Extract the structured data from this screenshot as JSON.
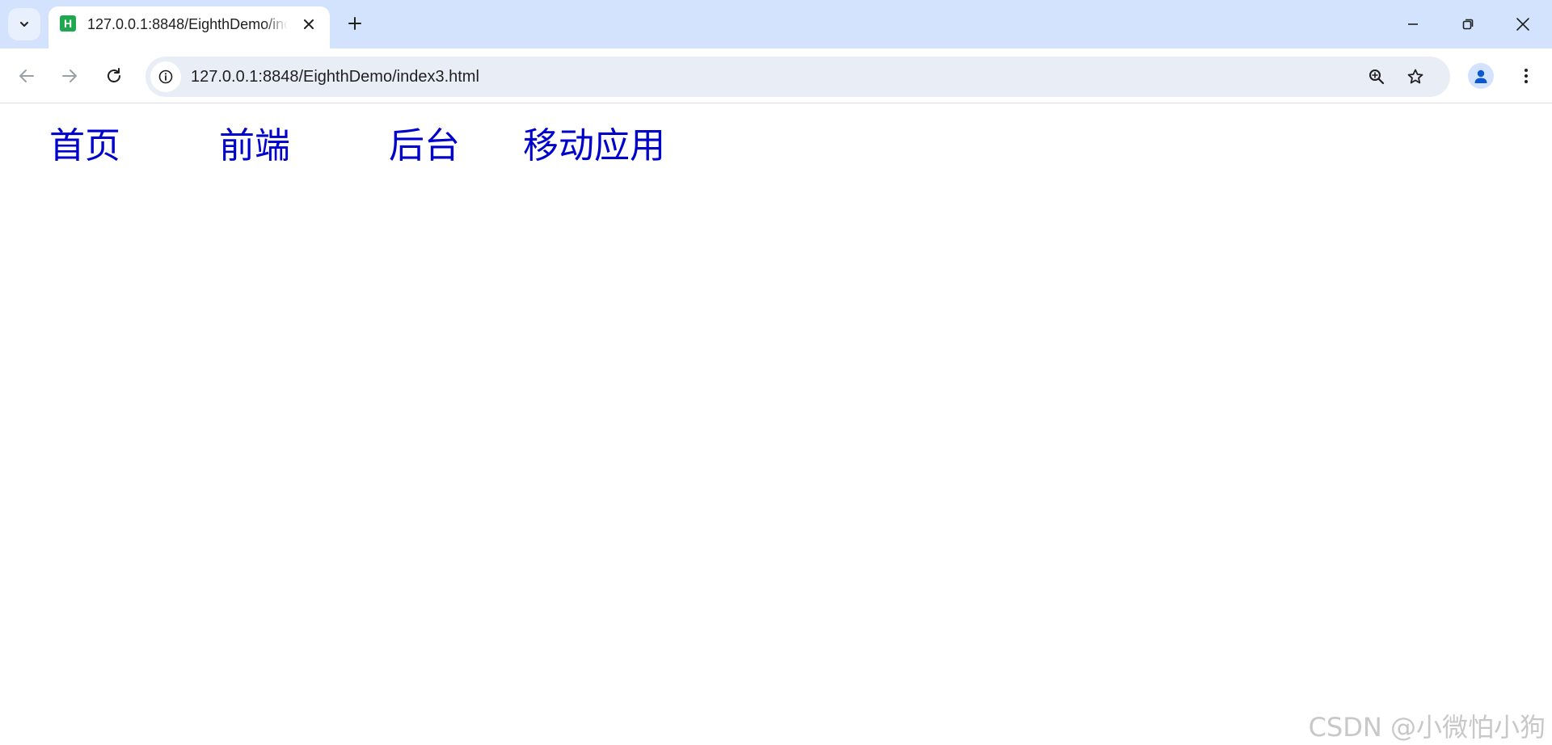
{
  "browser": {
    "tab": {
      "favicon_letter": "H",
      "title": "127.0.0.1:8848/EighthDemo/index3.html"
    },
    "address_bar": {
      "url": "127.0.0.1:8848/EighthDemo/index3.html"
    },
    "icons": {
      "tab_search": "chevron-down-icon",
      "tab_close": "close-icon",
      "new_tab": "plus-icon",
      "minimize": "minimize-icon",
      "restore": "restore-icon",
      "window_close": "close-icon",
      "back": "arrow-left-icon",
      "forward": "arrow-right-icon",
      "reload": "reload-icon",
      "site_info": "info-icon",
      "zoom": "zoom-icon",
      "bookmark": "star-icon",
      "profile": "person-icon",
      "menu": "more-vertical-icon"
    },
    "colors": {
      "tabstrip": "#d3e3fd",
      "omnibox": "#e9eef6",
      "favicon": "#1fa84f"
    }
  },
  "page": {
    "nav": [
      {
        "label": "首页"
      },
      {
        "label": "前端"
      },
      {
        "label": "后台"
      },
      {
        "label": "移动应用"
      }
    ],
    "link_color": "#0000cc",
    "watermark": "CSDN @小微怕小狗"
  }
}
